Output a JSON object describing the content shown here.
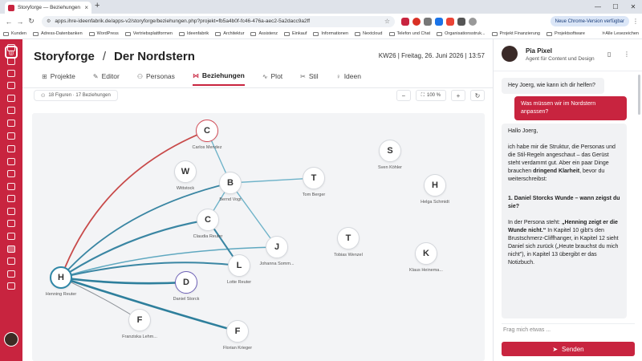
{
  "browser": {
    "tab_title": "Storyforge — Beziehungen — f",
    "url": "apps.ihre-ideenfabrik.de/apps-v2/storyforge/beziehungen.php?projekt=fb5a4b0f-fc46-476a-aec2-5a2dacc9a2ff",
    "update_button": "Neue Chrome-Version verfügbar",
    "bookmarks": [
      "Kunden",
      "Adress-Datenbanken",
      "WordPress",
      "Vertriebsplattformen",
      "Ideenfabrik",
      "Architektur",
      "Assistenz",
      "Einkauf",
      "Informationen",
      "Nextcloud",
      "Telefon und Chat",
      "Organisationsstruk...",
      "Projekt Finanzierung",
      "Projektsoftware"
    ],
    "all_bookmarks": "Alle Lesezeichen"
  },
  "header": {
    "app": "Storyforge",
    "separator": "/",
    "project": "Der Nordstern",
    "datetime": "KW26 | Freitag, 26. Juni 2026 | 13:57"
  },
  "tabs": [
    {
      "label": "Projekte",
      "icon": "grid-icon"
    },
    {
      "label": "Editor",
      "icon": "pencil-icon"
    },
    {
      "label": "Personas",
      "icon": "people-icon"
    },
    {
      "label": "Beziehungen",
      "icon": "network-icon",
      "active": true
    },
    {
      "label": "Plot",
      "icon": "plot-icon"
    },
    {
      "label": "Stil",
      "icon": "brush-icon"
    },
    {
      "label": "Ideen",
      "icon": "bulb-icon"
    }
  ],
  "toolbar": {
    "stats": "18 Figuren · 17 Beziehungen",
    "zoom_out": "−",
    "zoom": "100 %",
    "zoom_in": "+",
    "refresh": "↻"
  },
  "graph": {
    "nodes": [
      {
        "id": "carlos",
        "letter": "C",
        "name": "Carlos Mendez",
        "style": "red"
      },
      {
        "id": "wittstock",
        "letter": "W",
        "name": "Wittstock",
        "style": "plain"
      },
      {
        "id": "bernd",
        "letter": "B",
        "name": "Bernd Vogt",
        "style": "plain"
      },
      {
        "id": "tom",
        "letter": "T",
        "name": "Tom Berger",
        "style": "plain"
      },
      {
        "id": "sven",
        "letter": "S",
        "name": "Sven Köhler",
        "style": "plain"
      },
      {
        "id": "helga",
        "letter": "H",
        "name": "Helga Schmidt",
        "style": "plain"
      },
      {
        "id": "claudia",
        "letter": "C",
        "name": "Claudia Reuter",
        "style": "plain"
      },
      {
        "id": "johanna",
        "letter": "J",
        "name": "Johanna Somm...",
        "style": "plain"
      },
      {
        "id": "tobias",
        "letter": "T",
        "name": "Tobias Wenzel",
        "style": "plain"
      },
      {
        "id": "klaus",
        "letter": "K",
        "name": "Klaus Heinema...",
        "style": "plain"
      },
      {
        "id": "lotte",
        "letter": "L",
        "name": "Lotte Reuter",
        "style": "plain"
      },
      {
        "id": "henning",
        "letter": "H",
        "name": "Henning Reuter",
        "style": "blue"
      },
      {
        "id": "daniel",
        "letter": "D",
        "name": "Daniel Storck",
        "style": "purple"
      },
      {
        "id": "franziska",
        "letter": "F",
        "name": "Franziska Lehm...",
        "style": "plain"
      },
      {
        "id": "florian",
        "letter": "F",
        "name": "Florian Krieger",
        "style": "plain"
      }
    ],
    "edges": [
      {
        "from": "henning",
        "to": "carlos",
        "color": "#c84a4a",
        "width": 1.8
      },
      {
        "from": "henning",
        "to": "bernd",
        "color": "#3a86a3",
        "width": 1.8
      },
      {
        "from": "henning",
        "to": "claudia",
        "color": "#3a86a3",
        "width": 2.2
      },
      {
        "from": "henning",
        "to": "johanna",
        "color": "#5fa8c0",
        "width": 1.5
      },
      {
        "from": "henning",
        "to": "lotte",
        "color": "#3a86a3",
        "width": 2.0
      },
      {
        "from": "henning",
        "to": "daniel",
        "color": "#2e7f9c",
        "width": 2.6
      },
      {
        "from": "henning",
        "to": "florian",
        "color": "#2e7f9c",
        "width": 2.6
      },
      {
        "from": "henning",
        "to": "franziska",
        "color": "#8e9399",
        "width": 1.0
      },
      {
        "from": "carlos",
        "to": "bernd",
        "color": "#6fb3c9",
        "width": 1.4
      },
      {
        "from": "bernd",
        "to": "tom",
        "color": "#6fb3c9",
        "width": 1.4
      },
      {
        "from": "bernd",
        "to": "johanna",
        "color": "#6fb3c9",
        "width": 1.4
      },
      {
        "from": "bernd",
        "to": "claudia",
        "color": "#6fb3c9",
        "width": 1.4
      },
      {
        "from": "claudia",
        "to": "lotte",
        "color": "#3a86a3",
        "width": 2.0
      }
    ]
  },
  "chat": {
    "name": "Pia Pixel",
    "role": "Agent für Content und Design",
    "greeting": "Hey Joerg, wie kann ich dir helfen?",
    "user_msg": "Was müssen wir im Nordstern anpassen?",
    "reply": {
      "p1": "Hallo Joerg,",
      "p2a": "ich habe mir die Struktur, die Personas und die Stil-Regeln angeschaut – das Gerüst steht verdammt gut. Aber ein paar Dinge brauchen ",
      "p2b": "dringend Klarheit",
      "p2c": ", bevor du weiterschreibst:",
      "h1": "1. Daniel Storcks Wunde – wann zeigst du sie?",
      "p3a": "In der Persona steht: ",
      "p3b": "„Henning zeigt er die Wunde nicht.“",
      "p3c": " In Kapitel 10 gibt's den Brustschmerz-Cliffhanger, in Kapitel 12 sieht Daniel sich zurück („Heute brauchst du mich nicht\"), in Kapitel 13 übergibt er das Notizbuch."
    },
    "input_placeholder": "Frag mich etwas ...",
    "send_label": "Senden"
  },
  "colors": {
    "accent": "#c8243f"
  }
}
